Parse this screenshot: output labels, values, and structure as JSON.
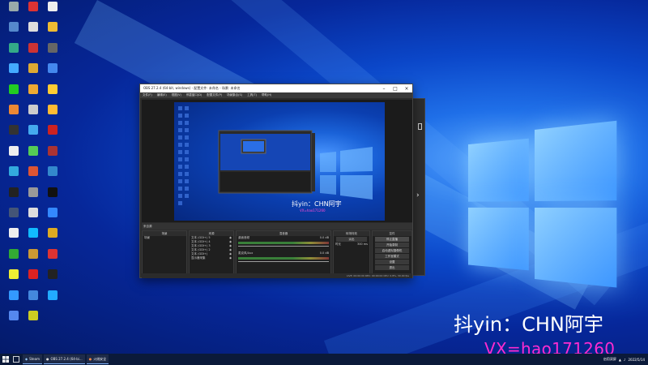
{
  "desktop": {
    "watermark": "抖yin：CHN阿宇",
    "vx_watermark": "VX=hao171260",
    "icons": [
      {
        "label": "",
        "color": "#9aa"
      },
      {
        "label": "",
        "color": "#d33"
      },
      {
        "label": "",
        "color": "#eee"
      },
      {
        "label": "",
        "color": "#58c"
      },
      {
        "label": "",
        "color": "#ddd"
      },
      {
        "label": "",
        "color": "#eb3"
      },
      {
        "label": "",
        "color": "#3a8"
      },
      {
        "label": "",
        "color": "#c33"
      },
      {
        "label": "",
        "color": "#666"
      },
      {
        "label": "",
        "color": "#4af"
      },
      {
        "label": "",
        "color": "#da3"
      },
      {
        "label": "",
        "color": "#48e"
      },
      {
        "label": "",
        "color": "#2c2"
      },
      {
        "label": "",
        "color": "#ea3"
      },
      {
        "label": "",
        "color": "#fc3"
      },
      {
        "label": "",
        "color": "#e83"
      },
      {
        "label": "",
        "color": "#ccc"
      },
      {
        "label": "",
        "color": "#fb3"
      },
      {
        "label": "",
        "color": "#333"
      },
      {
        "label": "",
        "color": "#4ae"
      },
      {
        "label": "",
        "color": "#c22"
      },
      {
        "label": "",
        "color": "#eee"
      },
      {
        "label": "",
        "color": "#5c5"
      },
      {
        "label": "",
        "color": "#a33"
      },
      {
        "label": "",
        "color": "#3ad"
      },
      {
        "label": "",
        "color": "#d53"
      },
      {
        "label": "",
        "color": "#38c"
      },
      {
        "label": "",
        "color": "#222"
      },
      {
        "label": "",
        "color": "#999"
      },
      {
        "label": "",
        "color": "#111"
      },
      {
        "label": "",
        "color": "#457"
      },
      {
        "label": "",
        "color": "#ddd"
      },
      {
        "label": "",
        "color": "#38f"
      },
      {
        "label": "",
        "color": "#eee"
      },
      {
        "label": "",
        "color": "#1bf"
      },
      {
        "label": "",
        "color": "#da2"
      },
      {
        "label": "",
        "color": "#3a3"
      },
      {
        "label": "",
        "color": "#c93"
      },
      {
        "label": "",
        "color": "#d33"
      },
      {
        "label": "",
        "color": "#ee3"
      },
      {
        "label": "",
        "color": "#d22"
      },
      {
        "label": "",
        "color": "#222"
      },
      {
        "label": "",
        "color": "#39f"
      },
      {
        "label": "",
        "color": "#48d"
      },
      {
        "label": "",
        "color": "#2af"
      },
      {
        "label": "",
        "color": "#58e"
      },
      {
        "label": "",
        "color": "#cc2"
      }
    ]
  },
  "obs": {
    "title": "OBS 27.2.4 (64-bit, windows) - 配置文件: 未命名 - 场景: 未命名",
    "menu": [
      "文件(F)",
      "编辑(E)",
      "视图(V)",
      "停靠窗口(D)",
      "配置文件(P)",
      "场景集合(S)",
      "工具(T)",
      "帮助(H)"
    ],
    "preview_label": "抖yin：CHN阿宇",
    "preview_sub": "VX=hao171260",
    "dock_title": "来自源",
    "docks": {
      "scenes": {
        "header": "场景",
        "items": [
          "场景"
        ]
      },
      "sources": {
        "header": "来源",
        "items": [
          "文本 (GDI+) 5",
          "文本 (GDI+) 4",
          "文本 (GDI+) 3",
          "文本 (GDI+) 2",
          "文本 (GDI+)",
          "显示器采集"
        ]
      },
      "mixer": {
        "header": "混音器",
        "channels": [
          "桌面音频",
          "麦克风/Aux"
        ],
        "levels": [
          "0.0 dB",
          "0.0 dB"
        ]
      },
      "transitions": {
        "header": "转场特效",
        "type": "淡出",
        "duration_label": "时长",
        "duration_value": "300 ms"
      },
      "controls": {
        "header": "控件",
        "buttons": [
          "停止直播",
          "开始录制",
          "启动虚拟摄像机",
          "工作室模式",
          "设置",
          "退出"
        ]
      }
    },
    "status": "LIVE: 00:00:00  REC: 00:00:00  CPU: 0.8%, 30.00 fps"
  },
  "taskbar": {
    "apps": [
      {
        "label": "Steam"
      },
      {
        "label": "OBS 27.2.4 (64-bi..."
      },
      {
        "label": "火绒安全"
      }
    ],
    "clock_time": "",
    "clock_date": "2022/5/14",
    "tray_text": "启用双屏"
  },
  "colors": {
    "accent": "#7fb3ff",
    "watermark_pink": "#ff2bd0"
  }
}
